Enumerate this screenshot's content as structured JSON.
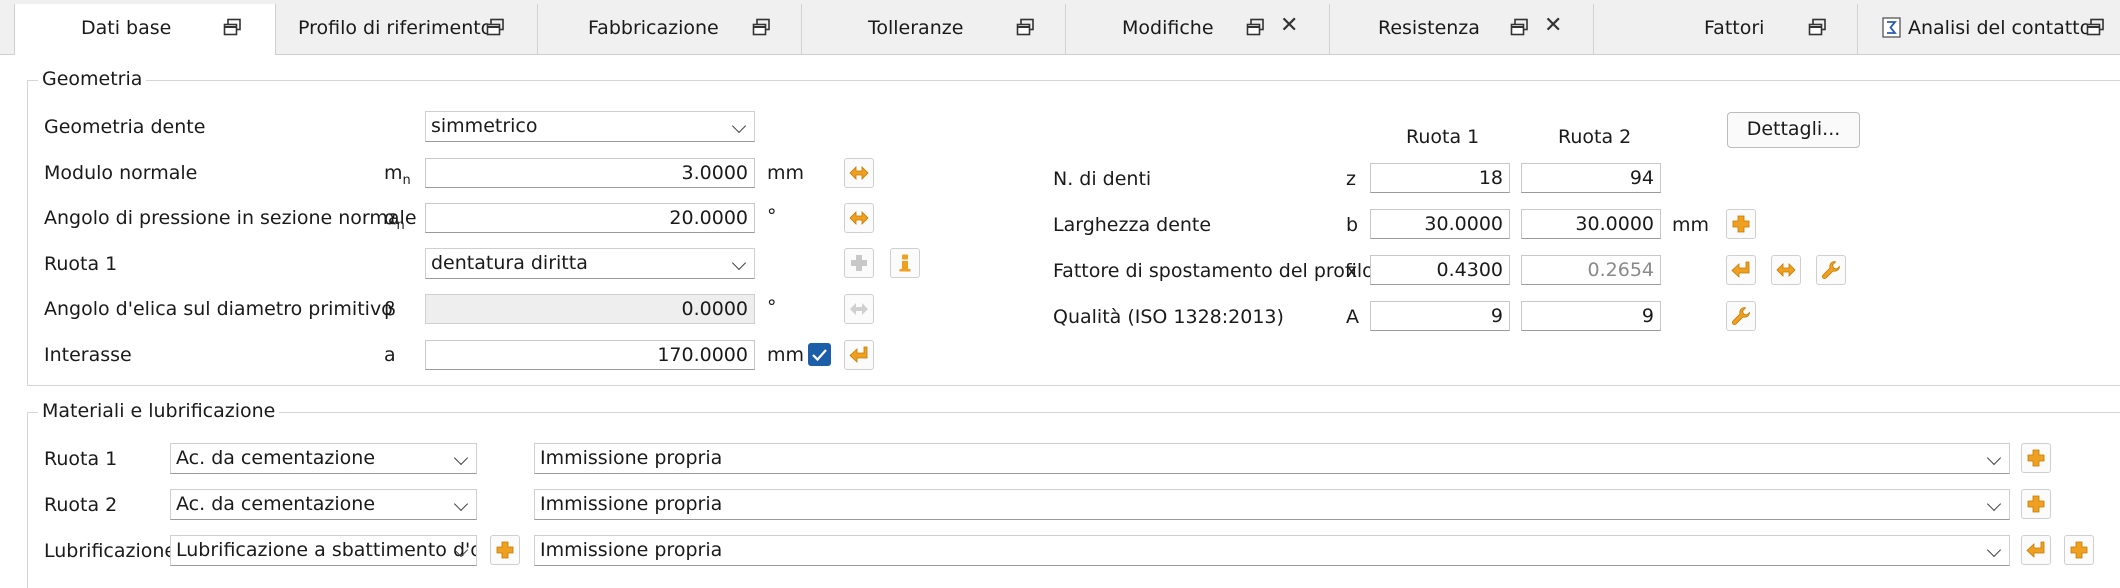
{
  "tabs": [
    {
      "label": "Dati base"
    },
    {
      "label": "Profilo di riferimento"
    },
    {
      "label": "Fabbricazione"
    },
    {
      "label": "Tolleranze"
    },
    {
      "label": "Modifiche",
      "close": "✕"
    },
    {
      "label": "Resistenza",
      "close": "✕"
    },
    {
      "label": "Fattori"
    },
    {
      "label": "Analisi del contatto"
    }
  ],
  "geometry": {
    "title": "Geometria",
    "rows": {
      "tooth_geometry": {
        "label": "Geometria dente",
        "value": "simmetrico"
      },
      "normal_module": {
        "label": "Modulo normale",
        "symbol": "m",
        "symbol_sub": "n",
        "value": "3.0000",
        "unit": "mm"
      },
      "pressure_angle": {
        "label": "Angolo di pressione in sezione normale",
        "symbol": "α",
        "symbol_sub": "n",
        "value": "20.0000",
        "unit": "°"
      },
      "gear1": {
        "label": "Ruota 1",
        "value": "dentatura diritta"
      },
      "helix_angle": {
        "label": "Angolo d'elica sul diametro primitivo",
        "symbol": "β",
        "value": "0.0000",
        "unit": "°"
      },
      "center_distance": {
        "label": "Interasse",
        "symbol": "a",
        "value": "170.0000",
        "unit": "mm"
      }
    },
    "columns": {
      "gear1": "Ruota 1",
      "gear2": "Ruota 2"
    },
    "details_button": "Dettagli...",
    "right_rows": {
      "teeth": {
        "label": "N. di denti",
        "symbol": "z",
        "v1": "18",
        "v2": "94"
      },
      "face_width": {
        "label": "Larghezza dente",
        "symbol": "b",
        "v1": "30.0000",
        "v2": "30.0000",
        "unit": "mm"
      },
      "profile_shift": {
        "label": "Fattore di spostamento del profilo",
        "symbol": "x",
        "v1": "0.4300",
        "v2": "0.2654"
      },
      "quality": {
        "label": "Qualità (ISO 1328:2013)",
        "symbol": "A",
        "v1": "9",
        "v2": "9"
      }
    }
  },
  "materials": {
    "title": "Materiali e lubrificazione",
    "rows": {
      "gear1": {
        "label": "Ruota 1",
        "material": "Ac. da cementazione",
        "spec": "Immissione propria"
      },
      "gear2": {
        "label": "Ruota 2",
        "material": "Ac. da cementazione",
        "spec": "Immissione propria"
      },
      "lube": {
        "label": "Lubrificazione",
        "material": "Lubrificazione a sbattimento d'ol",
        "spec": "Immissione propria"
      }
    }
  },
  "colors": {
    "accent_orange": "#f0a020",
    "checkbox_blue": "#1d5ea8",
    "tab_bg": "#f0f0f0"
  },
  "icons": [
    "window-restore-icon",
    "close-icon",
    "plus-icon",
    "arrow-left-icon",
    "arrows-horizontal-icon",
    "wrench-icon",
    "info-icon",
    "chevron-down-icon",
    "checkmark-icon",
    "sigma-report-icon"
  ]
}
